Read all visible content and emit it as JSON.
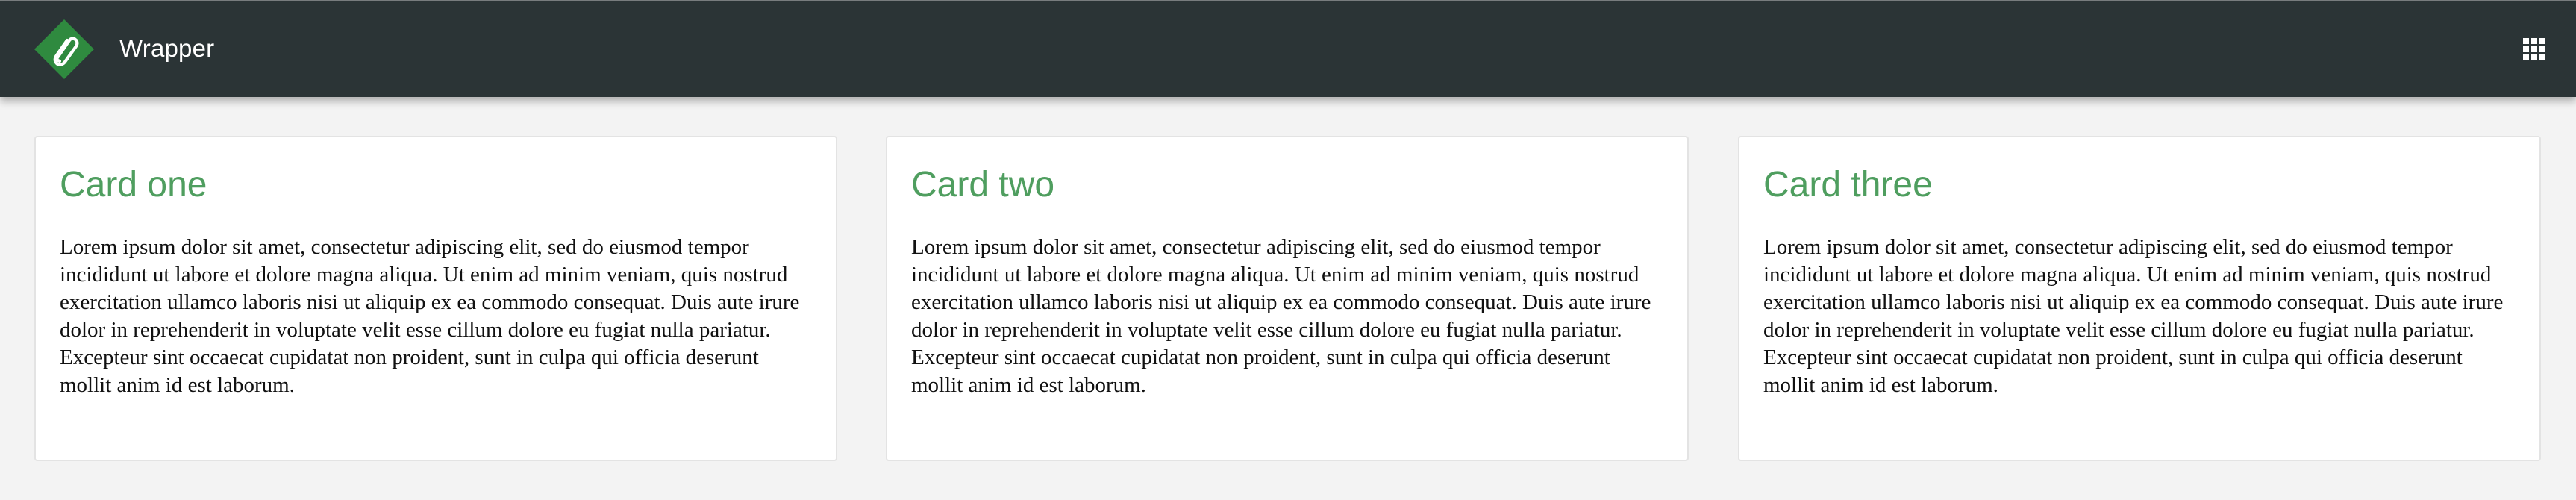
{
  "app": {
    "title": "Wrapper",
    "logo_icon": "paperclip-diamond-icon",
    "apps_icon": "grid-icon",
    "colors": {
      "header_bg": "#2b3436",
      "accent": "#4f9e5f",
      "page_bg": "#f3f3f3",
      "card_bg": "#ffffff"
    }
  },
  "cards": [
    {
      "title": "Card one",
      "body": "Lorem ipsum dolor sit amet, consectetur adipiscing elit, sed do eiusmod tempor incididunt ut labore et dolore magna aliqua. Ut enim ad minim veniam, quis nostrud exercitation ullamco laboris nisi ut aliquip ex ea commodo consequat. Duis aute irure dolor in reprehenderit in voluptate velit esse cillum dolore eu fugiat nulla pariatur. Excepteur sint occaecat cupidatat non proident, sunt in culpa qui officia deserunt mollit anim id est laborum."
    },
    {
      "title": "Card two",
      "body": "Lorem ipsum dolor sit amet, consectetur adipiscing elit, sed do eiusmod tempor incididunt ut labore et dolore magna aliqua. Ut enim ad minim veniam, quis nostrud exercitation ullamco laboris nisi ut aliquip ex ea commodo consequat. Duis aute irure dolor in reprehenderit in voluptate velit esse cillum dolore eu fugiat nulla pariatur. Excepteur sint occaecat cupidatat non proident, sunt in culpa qui officia deserunt mollit anim id est laborum."
    },
    {
      "title": "Card three",
      "body": "Lorem ipsum dolor sit amet, consectetur adipiscing elit, sed do eiusmod tempor incididunt ut labore et dolore magna aliqua. Ut enim ad minim veniam, quis nostrud exercitation ullamco laboris nisi ut aliquip ex ea commodo consequat. Duis aute irure dolor in reprehenderit in voluptate velit esse cillum dolore eu fugiat nulla pariatur. Excepteur sint occaecat cupidatat non proident, sunt in culpa qui officia deserunt mollit anim id est laborum."
    }
  ]
}
